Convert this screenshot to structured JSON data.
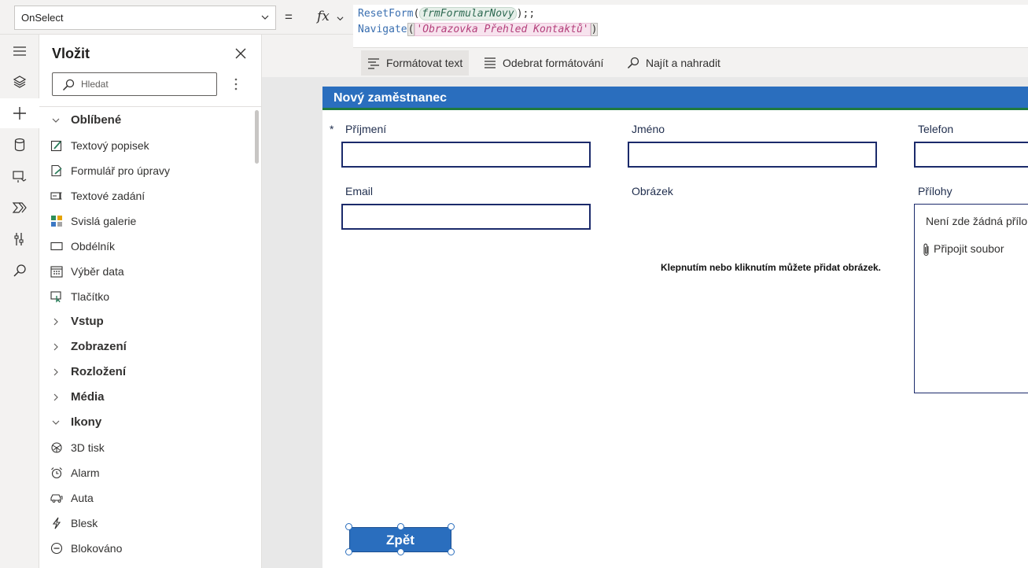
{
  "formula_bar": {
    "property": "OnSelect",
    "equals": "=",
    "fx_label": "fx",
    "line1": {
      "fn": "ResetForm",
      "open": "(",
      "arg": "frmFormularNovy",
      "close": ");;"
    },
    "line2": {
      "fn": "Navigate",
      "open": "(",
      "arg": "'Obrazovka Přehled Kontaktů'",
      "close": ")"
    }
  },
  "format_toolbar": {
    "format_text": "Formátovat text",
    "remove_format": "Odebrat formátování",
    "find_replace": "Najít a nahradit"
  },
  "insert_panel": {
    "title": "Vložit",
    "search_placeholder": "Hledat",
    "favorites_label": "Oblíbené",
    "favorites": [
      {
        "label": "Textový popisek",
        "icon": "text-label-icon"
      },
      {
        "label": "Formulář pro úpravy",
        "icon": "edit-form-icon"
      },
      {
        "label": "Textové zadání",
        "icon": "text-input-icon"
      },
      {
        "label": "Svislá galerie",
        "icon": "gallery-icon"
      },
      {
        "label": "Obdélník",
        "icon": "rectangle-icon"
      },
      {
        "label": "Výběr data",
        "icon": "calendar-icon"
      },
      {
        "label": "Tlačítko",
        "icon": "button-icon"
      }
    ],
    "categories": [
      "Vstup",
      "Zobrazení",
      "Rozložení",
      "Média"
    ],
    "icons_label": "Ikony",
    "icons": [
      {
        "label": "3D tisk",
        "icon": "3d-print-icon"
      },
      {
        "label": "Alarm",
        "icon": "alarm-icon"
      },
      {
        "label": "Auta",
        "icon": "car-icon"
      },
      {
        "label": "Blesk",
        "icon": "lightning-icon"
      },
      {
        "label": "Blokováno",
        "icon": "blocked-icon"
      }
    ]
  },
  "form": {
    "header": "Nový zaměstnanec",
    "required_mark": "*",
    "fields": {
      "surname": "Příjmení",
      "name": "Jméno",
      "phone": "Telefon",
      "email": "Email",
      "image": "Obrázek",
      "attachments": "Přílohy"
    },
    "image_hint": "Klepnutím nebo kliknutím můžete přidat obrázek.",
    "attachments_empty": "Není zde žádná příloha.",
    "attach_file": "Připojit soubor",
    "back_button": "Zpět"
  },
  "colors": {
    "header_blue": "#2a6ebe",
    "header_accent_green": "#1f7a3f",
    "input_border": "#1b2a6b"
  }
}
